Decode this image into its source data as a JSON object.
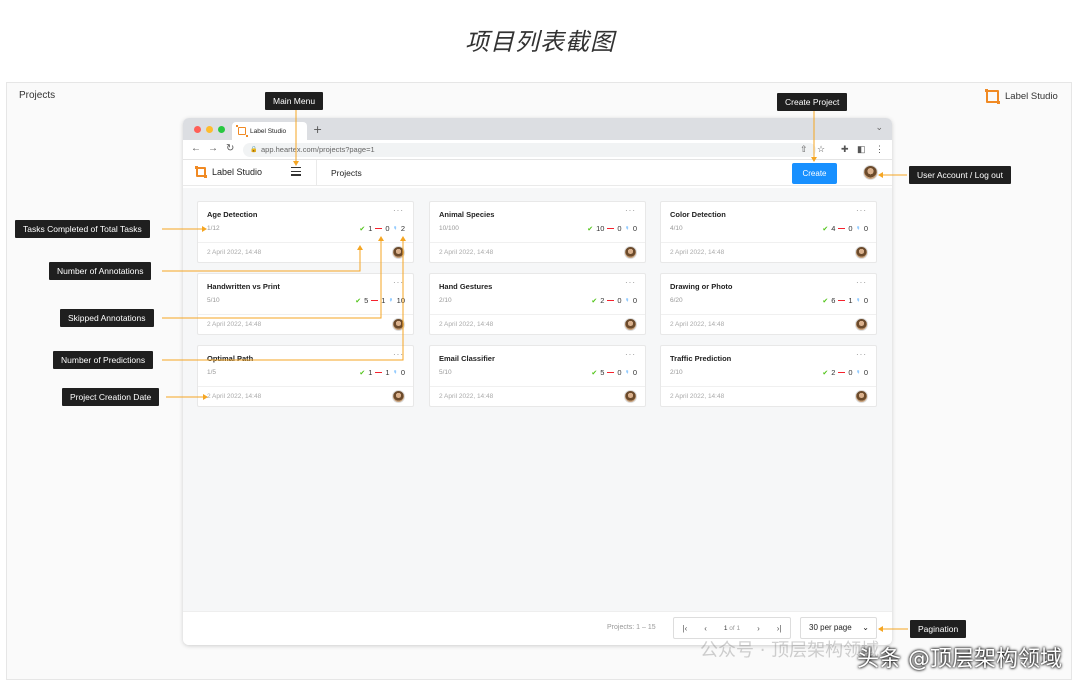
{
  "page": {
    "title": "项目列表截图",
    "section_label": "Projects",
    "brand": "Label Studio"
  },
  "browser": {
    "tab_title": "Label Studio",
    "url": "app.heartex.com/projects?page=1"
  },
  "app": {
    "logo_text": "Label Studio",
    "breadcrumb": "Projects",
    "create_label": "Create"
  },
  "projects": [
    {
      "title": "Age Detection",
      "tasks": "1/12",
      "completed": "1",
      "skipped": "0",
      "predictions": "2",
      "date": "2 April 2022, 14:48"
    },
    {
      "title": "Animal Species",
      "tasks": "10/100",
      "completed": "10",
      "skipped": "0",
      "predictions": "0",
      "date": "2 April 2022, 14:48"
    },
    {
      "title": "Color Detection",
      "tasks": "4/10",
      "completed": "4",
      "skipped": "0",
      "predictions": "0",
      "date": "2 April 2022, 14:48"
    },
    {
      "title": "Handwritten vs Print",
      "tasks": "5/10",
      "completed": "5",
      "skipped": "1",
      "predictions": "10",
      "date": "2 April 2022, 14:48"
    },
    {
      "title": "Hand Gestures",
      "tasks": "2/10",
      "completed": "2",
      "skipped": "0",
      "predictions": "0",
      "date": "2 April 2022, 14:48"
    },
    {
      "title": "Drawing or Photo",
      "tasks": "6/20",
      "completed": "6",
      "skipped": "1",
      "predictions": "0",
      "date": "2 April 2022, 14:48"
    },
    {
      "title": "Optimal Path",
      "tasks": "1/5",
      "completed": "1",
      "skipped": "1",
      "predictions": "0",
      "date": "2 April 2022, 14:48"
    },
    {
      "title": "Email Classifier",
      "tasks": "5/10",
      "completed": "5",
      "skipped": "0",
      "predictions": "0",
      "date": "2 April 2022, 14:48"
    },
    {
      "title": "Traffic Prediction",
      "tasks": "2/10",
      "completed": "2",
      "skipped": "0",
      "predictions": "0",
      "date": "2 April 2022, 14:48"
    }
  ],
  "footer": {
    "count": "Projects: 1 – 15",
    "page_current": "1",
    "page_of": "of 1",
    "per_page": "30 per page"
  },
  "callouts": {
    "main_menu": "Main Menu",
    "create_project": "Create Project",
    "user_account": "User Account / Log out",
    "tasks_completed": "Tasks Completed of Total Tasks",
    "num_annotations": "Number of Annotations",
    "skipped": "Skipped Annotations",
    "num_predictions": "Number of Predictions",
    "creation_date": "Project Creation Date",
    "pagination": "Pagination"
  },
  "watermark": {
    "faint": "公众号 · 顶层架构领域",
    "main": "头条 @顶层架构领域"
  },
  "colors": {
    "accent": "#1890ff",
    "brand_orange": "#f08a24",
    "callout_line": "#f5a623",
    "completed": "#52c41a",
    "skipped": "#f5222d"
  }
}
